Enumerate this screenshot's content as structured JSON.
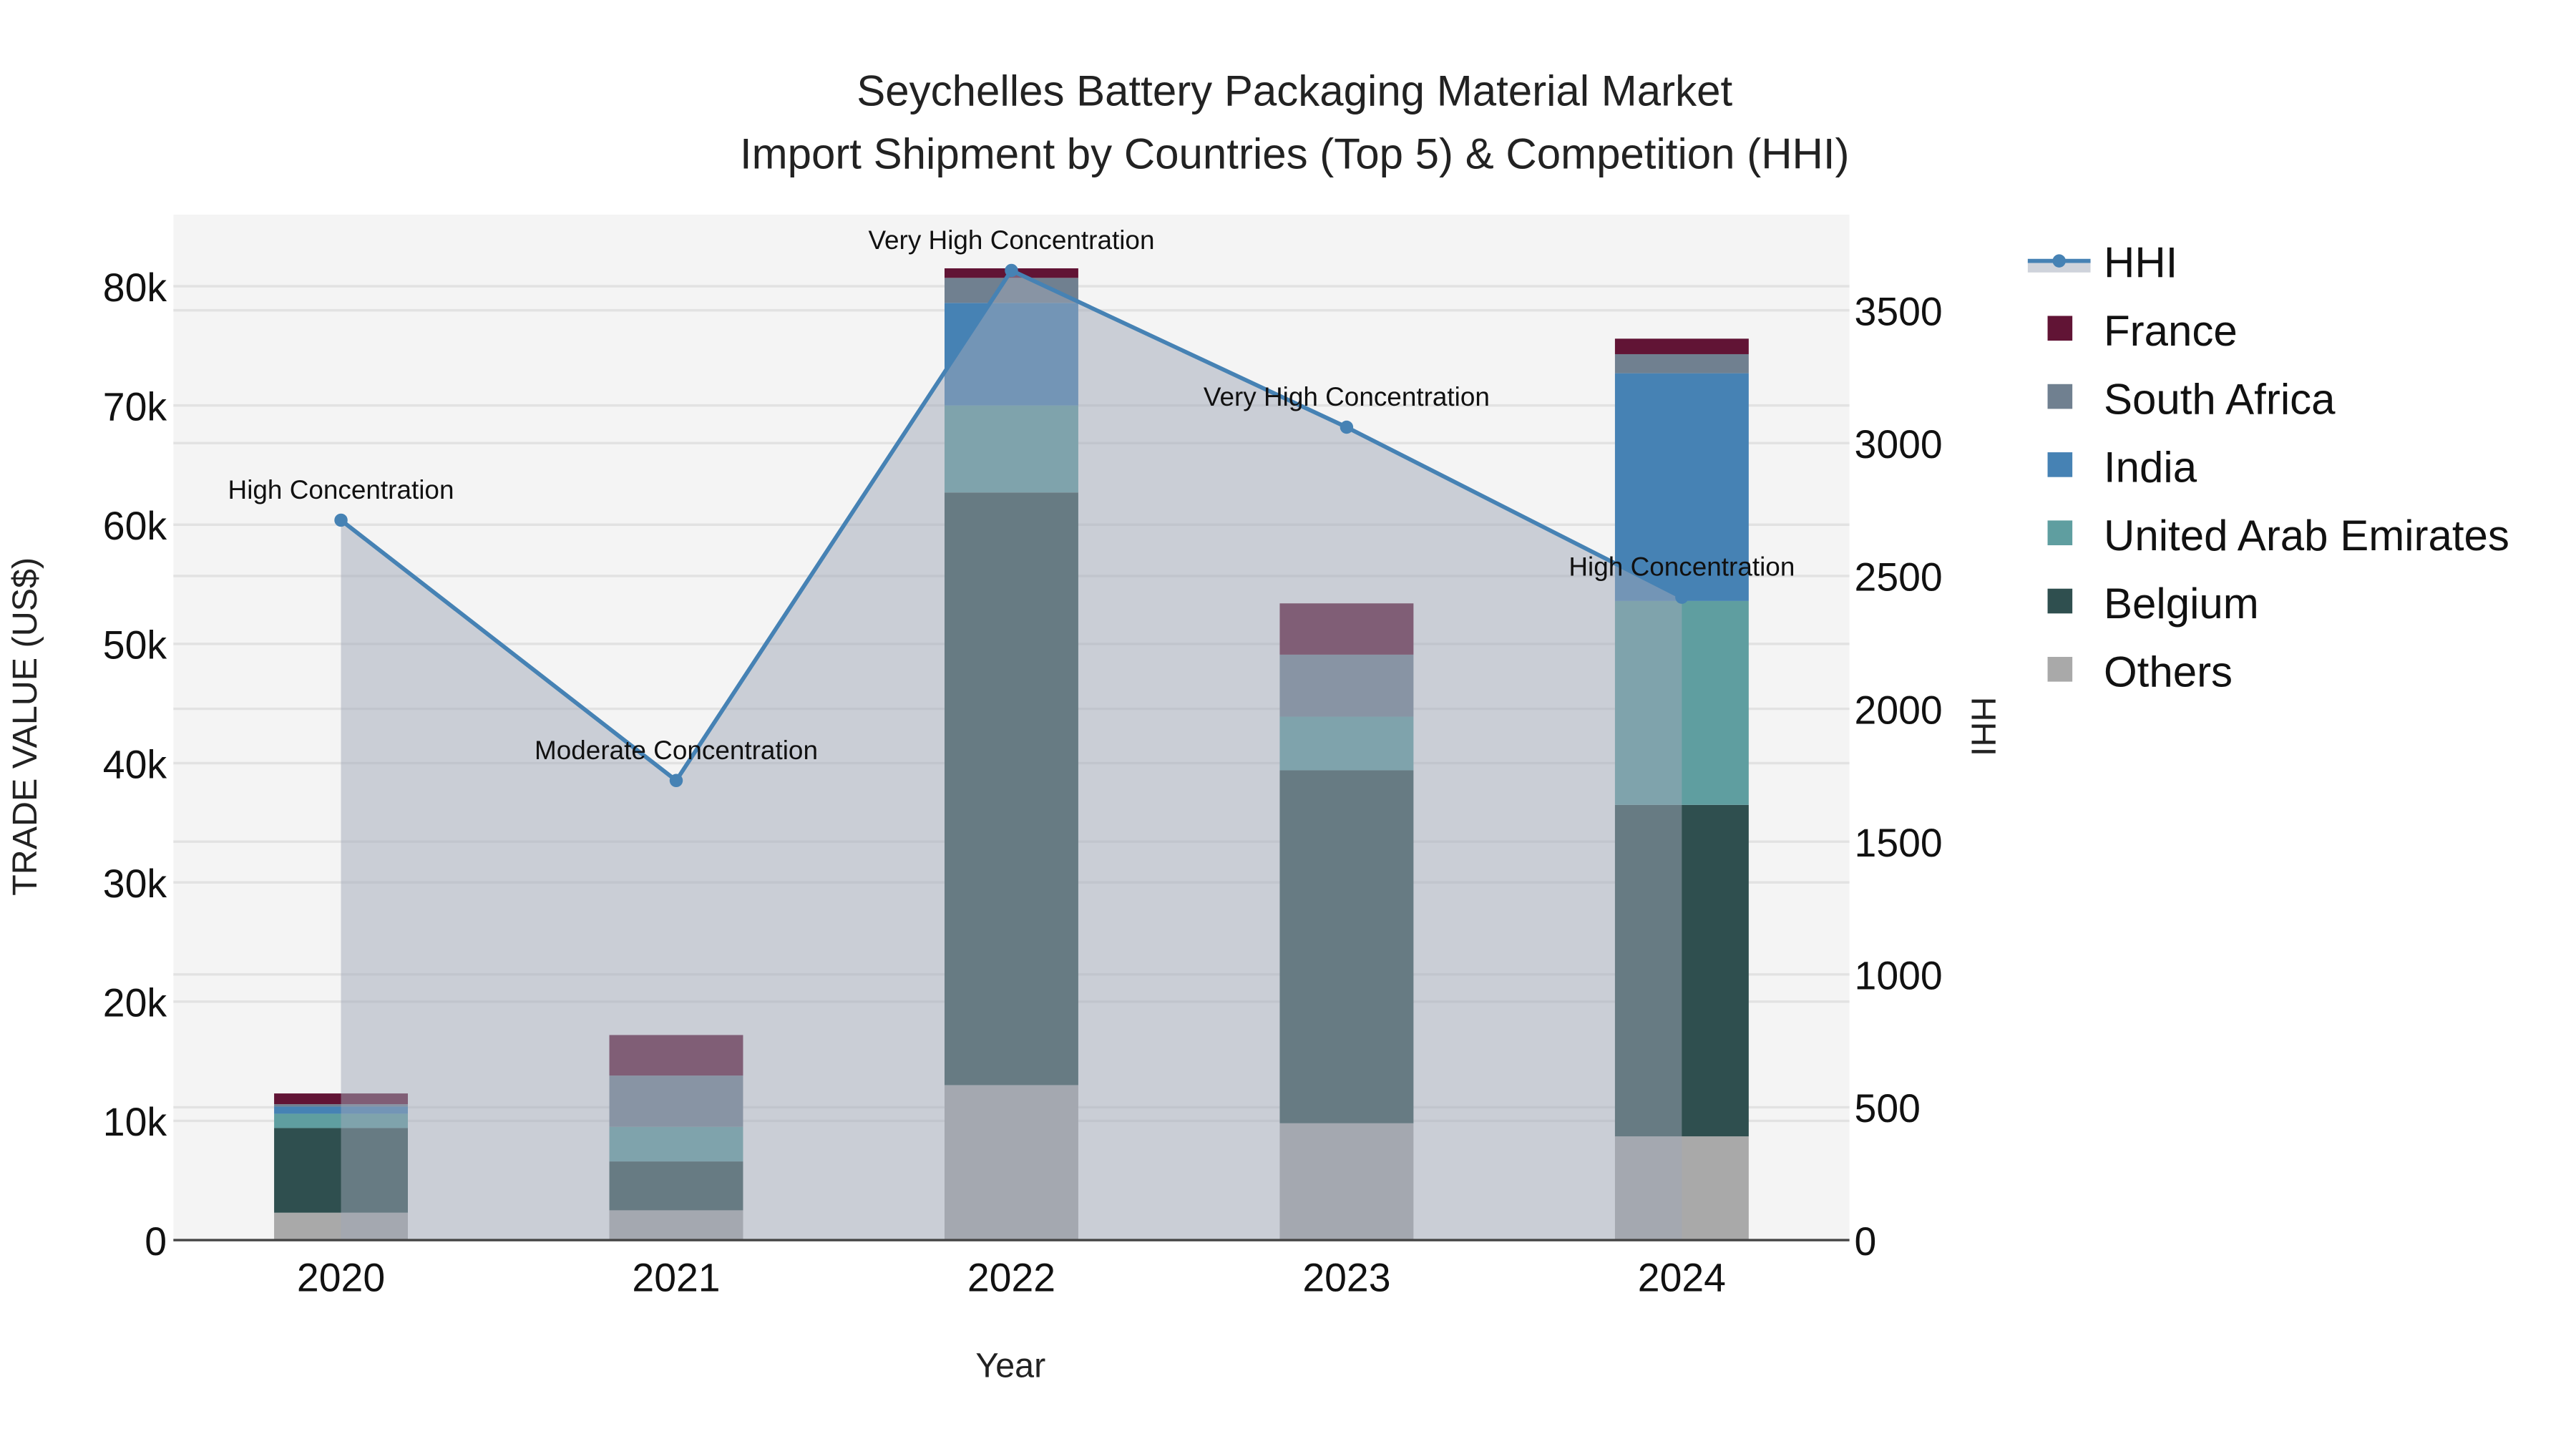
{
  "chart_data": {
    "type": "bar",
    "title_line1": "Seychelles Battery Packaging Material Market",
    "title_line2": "Import Shipment by Countries (Top 5) & Competition (HHI)",
    "xlabel": "Year",
    "ylabel": "TRADE VALUE (US$)",
    "y2label": "HHI",
    "categories": [
      "2020",
      "2021",
      "2022",
      "2023",
      "2024"
    ],
    "ylim": [
      0,
      86000
    ],
    "y2lim": [
      0,
      3860
    ],
    "yticks": [
      0,
      10000,
      20000,
      30000,
      40000,
      50000,
      60000,
      70000,
      80000
    ],
    "ytick_labels": [
      "0",
      "10k",
      "20k",
      "30k",
      "40k",
      "50k",
      "60k",
      "70k",
      "80k"
    ],
    "y2ticks": [
      0,
      500,
      1000,
      1500,
      2000,
      2500,
      3000,
      3500
    ],
    "y2tick_labels": [
      "0",
      "500",
      "1000",
      "1500",
      "2000",
      "2500",
      "3000",
      "3500"
    ],
    "barmode": "stack",
    "series": [
      {
        "name": "Others",
        "color": "#a9a9a9",
        "values": [
          2300,
          2500,
          13000,
          9800,
          8700
        ]
      },
      {
        "name": "Belgium",
        "color": "#2f4f4f",
        "values": [
          7100,
          4100,
          49700,
          29600,
          27800
        ]
      },
      {
        "name": "United Arab Emirates",
        "color": "#5f9ea0",
        "values": [
          1200,
          2900,
          7300,
          4500,
          17100
        ]
      },
      {
        "name": "India",
        "color": "#4682b4",
        "values": [
          600,
          0,
          8600,
          0,
          19100
        ]
      },
      {
        "name": "South Africa",
        "color": "#708090",
        "values": [
          200,
          4300,
          2100,
          5200,
          1600
        ]
      },
      {
        "name": "France",
        "color": "#611435",
        "values": [
          900,
          3400,
          800,
          4300,
          1300
        ]
      }
    ],
    "hhi": {
      "name": "HHI",
      "color": "#4682b4",
      "values": [
        2710,
        1730,
        3650,
        3060,
        2420
      ],
      "annotations": [
        "High Concentration",
        "Moderate Concentration",
        "Very High Concentration",
        "Very High Concentration",
        "High Concentration"
      ]
    },
    "legend_order": [
      "HHI",
      "France",
      "South Africa",
      "India",
      "United Arab Emirates",
      "Belgium",
      "Others"
    ],
    "legend_position": "right",
    "grid": true
  }
}
